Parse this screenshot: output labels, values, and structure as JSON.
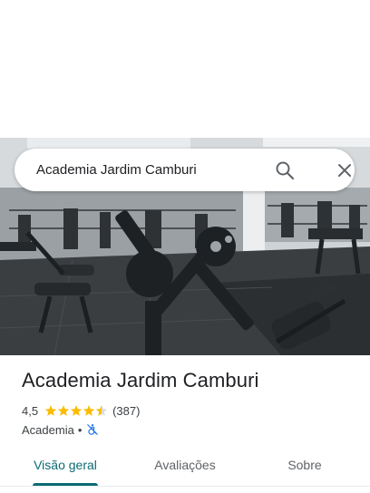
{
  "search": {
    "query": "Academia Jardim Camburi"
  },
  "place": {
    "title": "Academia Jardim Camburi",
    "rating": "4,5",
    "rating_value": 4.5,
    "review_count": "(387)",
    "category": "Academia",
    "separator": "•"
  },
  "tabs": [
    {
      "label": "Visão geral",
      "active": true
    },
    {
      "label": "Avaliações",
      "active": false
    },
    {
      "label": "Sobre",
      "active": false
    }
  ],
  "colors": {
    "accent": "#0b6b74",
    "star": "#fbbc04",
    "accessibility_icon": "#1a73e8"
  },
  "icons": [
    "search-icon",
    "close-icon",
    "star-icon",
    "accessibility-icon"
  ]
}
